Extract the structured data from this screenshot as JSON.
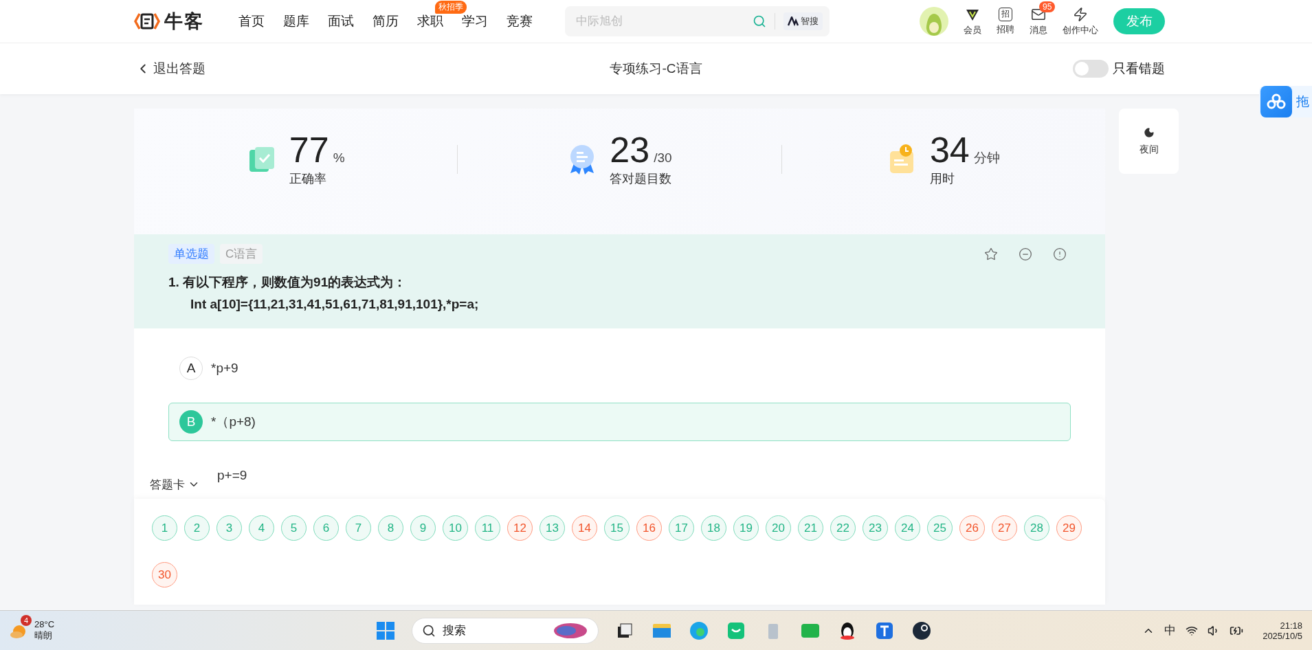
{
  "top_nav": {
    "logo_text": "牛客",
    "items": [
      {
        "label": "首页"
      },
      {
        "label": "题库"
      },
      {
        "label": "面试"
      },
      {
        "label": "简历"
      },
      {
        "label": "求职",
        "badge": "秋招季"
      },
      {
        "label": "学习"
      },
      {
        "label": "竞赛"
      }
    ],
    "search": {
      "placeholder": "中际旭创",
      "ai_button": "智搜"
    },
    "tools": [
      {
        "kind": "vip",
        "label": "会员"
      },
      {
        "kind": "recruit",
        "label": "招聘",
        "glyph": "招"
      },
      {
        "kind": "message",
        "label": "消息",
        "badge": "95"
      },
      {
        "kind": "create",
        "label": "创作中心"
      }
    ],
    "publish_button": "发布"
  },
  "sub_header": {
    "back": "退出答题",
    "title": "专项练习-C语言",
    "toggle": {
      "label": "只看错题",
      "on": false
    }
  },
  "side_float": {
    "text": "拖"
  },
  "stats": [
    {
      "kind": "accuracy",
      "value": "77",
      "unit": "%",
      "label": "正确率"
    },
    {
      "kind": "correct",
      "value": "23",
      "unit": "/30",
      "label": "答对题目数"
    },
    {
      "kind": "time",
      "value": "34",
      "unit": "分钟",
      "label": "用时"
    }
  ],
  "night_button": "夜间",
  "question": {
    "tags": [
      {
        "label": "单选题",
        "kind": "type"
      },
      {
        "label": "C语言",
        "kind": "topic"
      }
    ],
    "title": "1. 有以下程序，则数值为91的表达式为：",
    "code": "Int a[10]={11,21,31,41,51,61,71,81,91,101},*p=a;",
    "options": [
      {
        "letter": "A",
        "text": "*p+9",
        "selected": false
      },
      {
        "letter": "B",
        "text": "*（p+8)",
        "selected": true
      },
      {
        "text": "p+=9",
        "selected": false
      }
    ]
  },
  "answer_card": {
    "title": "答题卡",
    "items": [
      {
        "label": "1",
        "correct": true
      },
      {
        "label": "2",
        "correct": true
      },
      {
        "label": "3",
        "correct": true
      },
      {
        "label": "4",
        "correct": true
      },
      {
        "label": "5",
        "correct": true
      },
      {
        "label": "6",
        "correct": true
      },
      {
        "label": "7",
        "correct": true
      },
      {
        "label": "8",
        "correct": true
      },
      {
        "label": "9",
        "correct": true
      },
      {
        "label": "10",
        "correct": true
      },
      {
        "label": "11",
        "correct": true
      },
      {
        "label": "12",
        "correct": false
      },
      {
        "label": "13",
        "correct": true
      },
      {
        "label": "14",
        "correct": false
      },
      {
        "label": "15",
        "correct": true
      },
      {
        "label": "16",
        "correct": false
      },
      {
        "label": "17",
        "correct": true
      },
      {
        "label": "18",
        "correct": true
      },
      {
        "label": "19",
        "correct": true
      },
      {
        "label": "20",
        "correct": true
      },
      {
        "label": "21",
        "correct": true
      },
      {
        "label": "22",
        "correct": true
      },
      {
        "label": "23",
        "correct": true
      },
      {
        "label": "24",
        "correct": true
      },
      {
        "label": "25",
        "correct": true
      },
      {
        "label": "26",
        "correct": false
      },
      {
        "label": "27",
        "correct": false
      },
      {
        "label": "28",
        "correct": true
      },
      {
        "label": "29",
        "correct": false
      },
      {
        "label": "30",
        "correct": false
      }
    ]
  },
  "taskbar": {
    "weather": {
      "badge": "4",
      "temp": "28°C",
      "text": "晴朗"
    },
    "search": "搜索",
    "ime": "中",
    "time": "21:18",
    "date": "2025/10/5"
  }
}
